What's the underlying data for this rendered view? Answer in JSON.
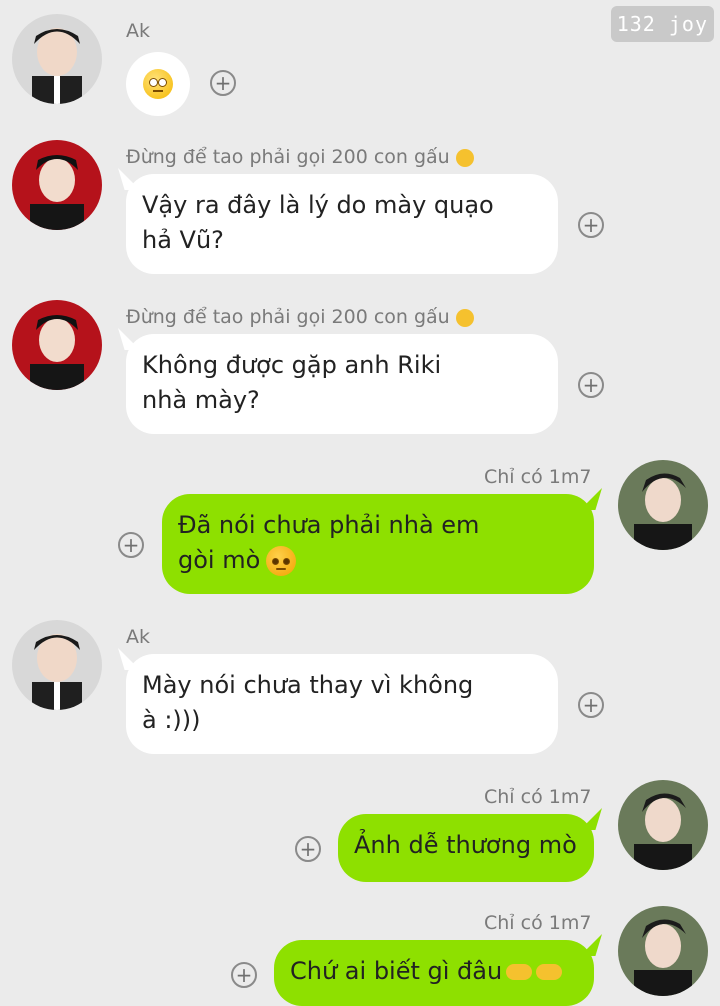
{
  "watermark": "132 joy",
  "messages": [
    {
      "sender": "Ak",
      "text": "",
      "emoji": "face-with-rolling-eyes"
    },
    {
      "sender": "Đừng để tao phải gọi 200 con gấu",
      "sender_emoji": "ok-hand",
      "lines": [
        "Vậy ra đây là lý do mày quạo",
        "hả Vũ?"
      ]
    },
    {
      "sender": "Đừng để tao phải gọi 200 con gấu",
      "sender_emoji": "ok-hand",
      "lines": [
        "Không được gặp anh Riki",
        "nhà mày?"
      ]
    },
    {
      "sender": "Chỉ có 1m7",
      "lines": [
        "Đã nói chưa phải nhà em",
        "gòi mò"
      ],
      "emoji": "angry-face"
    },
    {
      "sender": "Ak",
      "lines": [
        "Mày nói chưa thay vì không",
        "à :)))"
      ]
    },
    {
      "sender": "Chỉ có 1m7",
      "lines": [
        "Ảnh dễ thương mò"
      ]
    },
    {
      "sender": "Chỉ có 1m7",
      "lines": [
        "Chứ ai biết gì đâu"
      ],
      "emoji": "pointing-hands"
    }
  ],
  "colors": {
    "incoming": "#ffffff",
    "outgoing": "#8ee000",
    "background": "#ebebeb"
  }
}
